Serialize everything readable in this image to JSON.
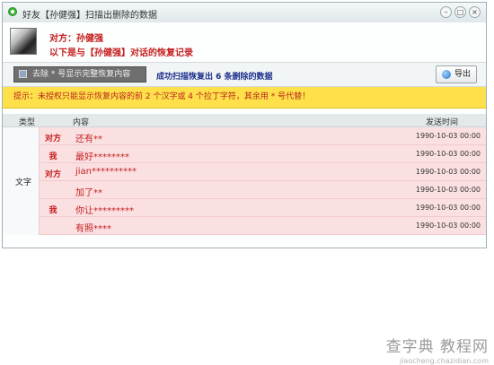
{
  "window": {
    "title": "好友【孙健强】扫描出删除的数据",
    "controls": [
      "–",
      "□",
      "×"
    ]
  },
  "header": {
    "line1": "对方：孙健强",
    "line2": "以下是与【孙健强】对话的恢复记录"
  },
  "toolbar": {
    "remove_label": "去除 * 号显示完整恢复内容",
    "scan_message": "成功扫描恢复出 6 条删除的数据",
    "export_label": "导出"
  },
  "tip": "提示：未授权只能显示恢复内容的前 2 个汉字或 4 个拉丁字符，其余用 * 号代替！",
  "table": {
    "headers": {
      "type": "类型",
      "content": "内容",
      "time": "发送时间"
    },
    "type_value": "文字",
    "rows": [
      {
        "who": "对方",
        "content": "还有**",
        "time": "1990-10-03 00:00"
      },
      {
        "who": "我",
        "content": "最好********",
        "time": "1990-10-03 00:00"
      },
      {
        "who": "对方",
        "content": "jian**********",
        "time": "1990-10-03 00:00"
      },
      {
        "who": "",
        "content": "加了**",
        "time": "1990-10-03 00:00"
      },
      {
        "who": "我",
        "content": "你让*********",
        "time": "1990-10-03 00:00"
      },
      {
        "who": "",
        "content": "有照****",
        "time": "1990-10-03 00:00"
      }
    ]
  },
  "watermark": {
    "main": "查字典 教程网",
    "sub": "jiaocheng.chazidian.com"
  }
}
